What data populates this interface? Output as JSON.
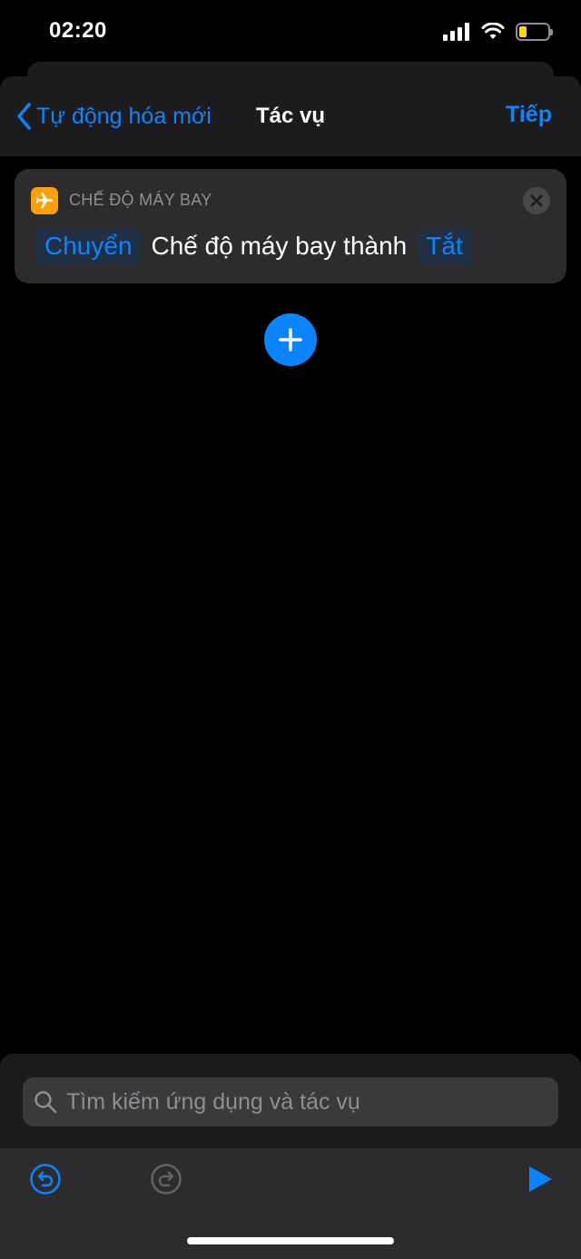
{
  "status_bar": {
    "time": "02:20",
    "signal_icon": "cellular-signal-icon",
    "wifi_icon": "wifi-icon",
    "battery_icon": "battery-icon",
    "battery_level": 0.25,
    "battery_color": "#ffd60a"
  },
  "nav": {
    "back_label": "Tự động hóa mới",
    "title": "Tác vụ",
    "next_label": "Tiếp"
  },
  "action": {
    "app_icon": "airplane-icon",
    "app_icon_color": "#ff9f0a",
    "category": "CHẾ ĐỘ MÁY BAY",
    "verb_token": "Chuyển",
    "sentence_text": "Chế độ máy bay thành",
    "value_token": "Tắt",
    "remove_icon": "close-icon"
  },
  "add_action_icon": "plus-icon",
  "search": {
    "placeholder": "Tìm kiếm ứng dụng và tác vụ",
    "value": ""
  },
  "toolbar": {
    "undo_icon": "undo-icon",
    "redo_icon": "redo-icon",
    "run_icon": "play-icon"
  },
  "colors": {
    "accent": "#0a84ff",
    "background": "#000000",
    "card": "#2c2c2e",
    "secondary_text": "#8e8e93"
  }
}
